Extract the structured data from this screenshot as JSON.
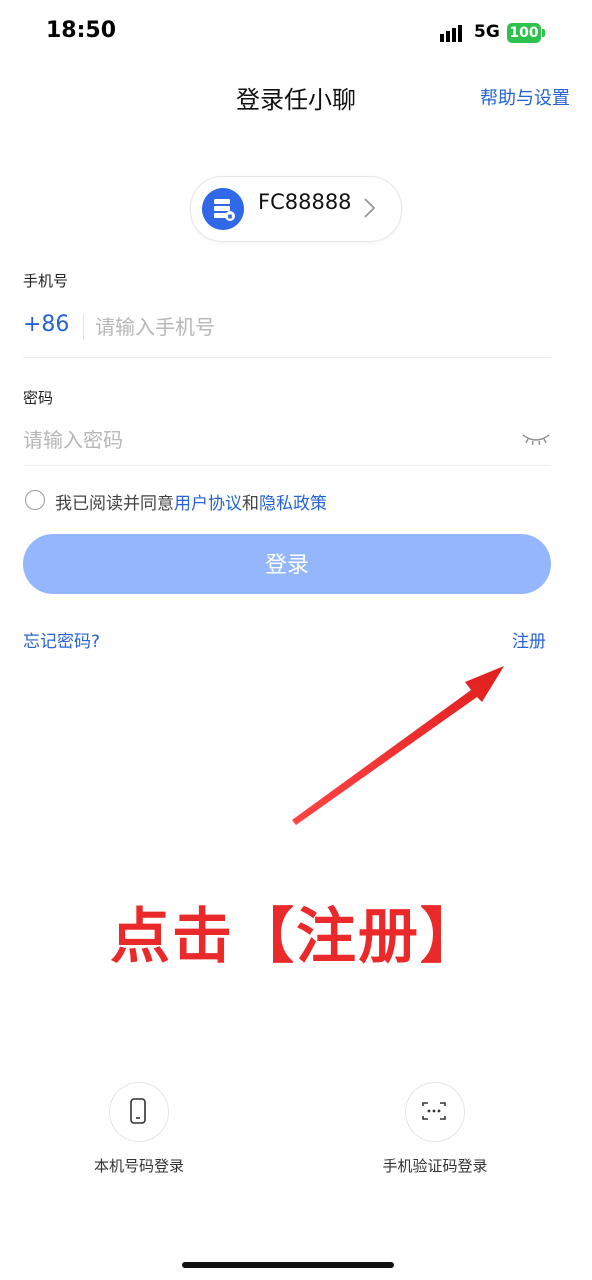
{
  "status_bar": {
    "time": "18:50",
    "network": "5G",
    "battery": "100"
  },
  "header": {
    "title": "登录任小聊",
    "help_link": "帮助与设置"
  },
  "server": {
    "code": "FC88888"
  },
  "phone": {
    "label": "手机号",
    "country_code": "+86",
    "placeholder": "请输入手机号"
  },
  "password": {
    "label": "密码",
    "placeholder": "请输入密码"
  },
  "agreement": {
    "prefix": "我已阅读并同意",
    "terms": "用户协议",
    "and": "和",
    "privacy": "隐私政策"
  },
  "buttons": {
    "login": "登录",
    "forgot": "忘记密码?",
    "register": "注册"
  },
  "annotation": {
    "text": "点击【注册】",
    "color": "#ea2a2a"
  },
  "alt_login": {
    "local_number": "本机号码登录",
    "sms_code": "手机验证码登录"
  },
  "colors": {
    "accent": "#2563d7",
    "login_button": "#94b6fb",
    "battery": "#2fc14e"
  }
}
